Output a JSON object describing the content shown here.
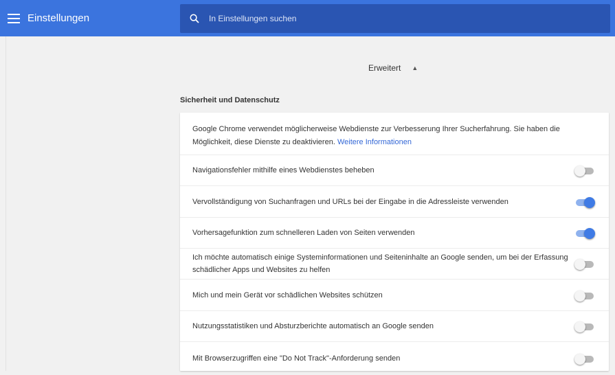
{
  "header": {
    "title": "Einstellungen",
    "search_placeholder": "In Einstellungen suchen"
  },
  "advanced": {
    "label": "Erweitert",
    "caret": "▲"
  },
  "section": {
    "title": "Sicherheit und Datenschutz"
  },
  "intro": {
    "text": "Google Chrome verwendet möglicherweise Webdienste zur Verbesserung Ihrer Sucherfahrung. Sie haben die Möglichkeit, diese Dienste zu deaktivieren.",
    "link": "Weitere Informationen"
  },
  "settings": [
    {
      "label": "Navigationsfehler mithilfe eines Webdienstes beheben",
      "enabled": false
    },
    {
      "label": "Vervollständigung von Suchanfragen und URLs bei der Eingabe in die Adressleiste verwenden",
      "enabled": true
    },
    {
      "label": "Vorhersagefunktion zum schnelleren Laden von Seiten verwenden",
      "enabled": true
    },
    {
      "label": "Ich möchte automatisch einige Systeminformationen und Seiteninhalte an Google senden, um bei der Erfassung schädlicher Apps und Websites zu helfen",
      "enabled": false
    },
    {
      "label": "Mich und mein Gerät vor schädlichen Websites schützen",
      "enabled": false
    },
    {
      "label": "Nutzungsstatistiken und Absturzberichte automatisch an Google senden",
      "enabled": false
    },
    {
      "label": "Mit Browserzugriffen eine \"Do Not Track\"-Anforderung senden",
      "enabled": false
    }
  ],
  "colors": {
    "header_bg": "#3b74de",
    "search_bg": "#2a55b2",
    "toggle_on": "#3f7be5",
    "link": "#3367d6"
  }
}
